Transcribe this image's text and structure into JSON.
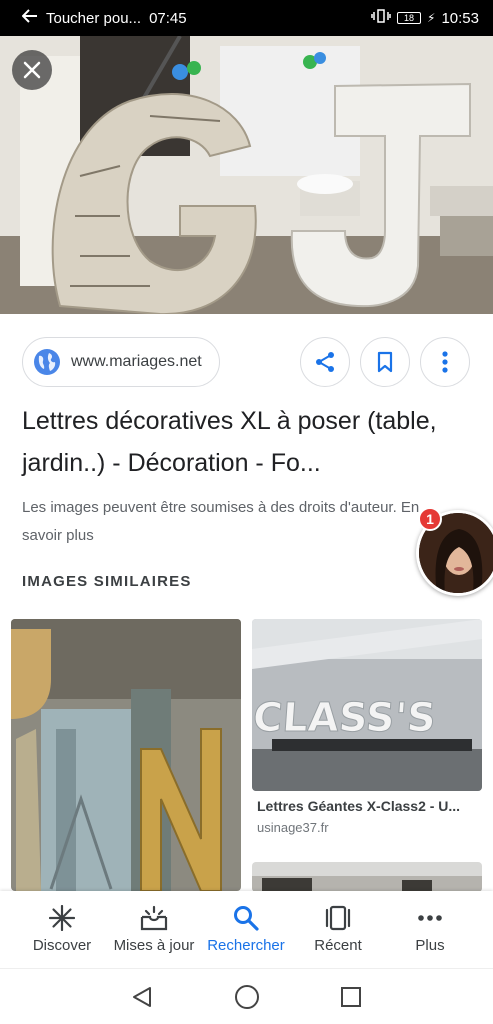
{
  "status_bar": {
    "back_text": "Toucher pou...",
    "left_time": "07:45",
    "battery": "18",
    "clock": "10:53"
  },
  "hero": {
    "alt_icon": "close-icon"
  },
  "source": {
    "domain": "www.mariages.net",
    "icon": "globe-icon"
  },
  "actions": {
    "share_icon": "share-icon",
    "bookmark_icon": "bookmark-icon",
    "more_icon": "more-vert-icon"
  },
  "result": {
    "title": "Lettres décoratives XL à poser (table, jardin..) - Décoration - Fo...",
    "copyright": "Les images peuvent être soumises à des droits d'auteur. En savoir plus"
  },
  "chat_head": {
    "badge_count": "1"
  },
  "similar": {
    "heading": "IMAGES SIMILAIRES",
    "items": [
      {
        "caption": "Lettres Géantes X-Class2 - U...",
        "source": "usinage37.fr"
      }
    ]
  },
  "bottom_nav": {
    "items": [
      {
        "label": "Discover",
        "icon": "asterisk-icon"
      },
      {
        "label": "Mises à jour",
        "icon": "updates-icon"
      },
      {
        "label": "Rechercher",
        "icon": "search-icon"
      },
      {
        "label": "Récent",
        "icon": "recent-icon"
      },
      {
        "label": "Plus",
        "icon": "more-horiz-icon"
      }
    ],
    "active_index": 2
  },
  "colors": {
    "accent": "#1a73e8",
    "badge": "#e53935",
    "text_primary": "#202124",
    "text_secondary": "#5f6368"
  }
}
